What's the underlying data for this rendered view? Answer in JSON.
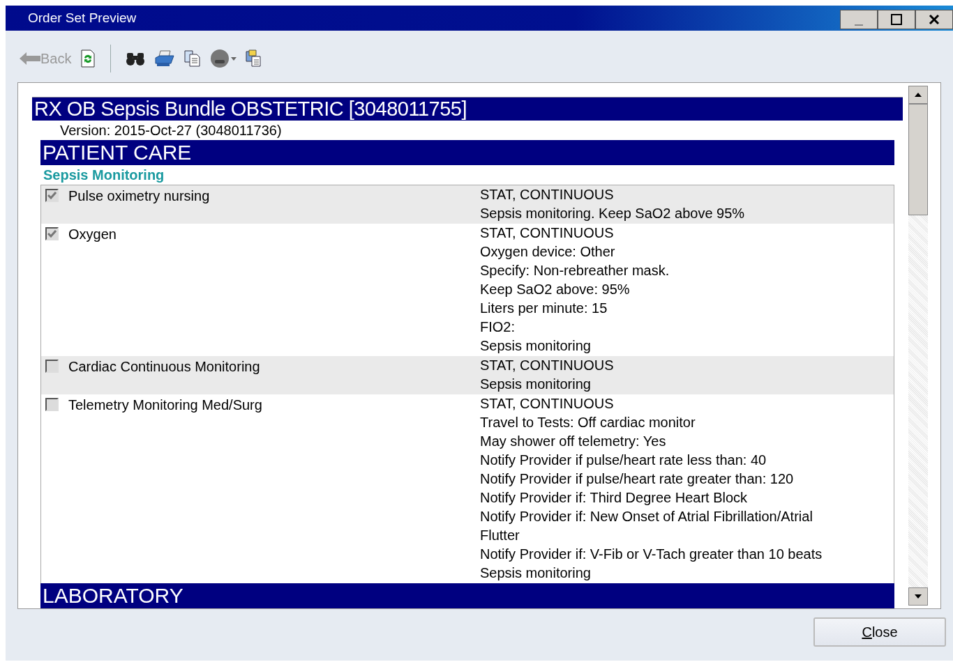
{
  "window": {
    "title": "Order Set Preview"
  },
  "toolbar": {
    "back": {
      "label": "Back",
      "disabled": true
    }
  },
  "document": {
    "title": "RX OB Sepsis Bundle OBSTETRIC [3048011755]",
    "version": "Version: 2015-Oct-27 (3048011736)",
    "sections": [
      {
        "heading": "PATIENT CARE",
        "subsections": [
          {
            "heading": "Sepsis Monitoring",
            "orders": [
              {
                "name": "Pulse oximetry nursing",
                "checked": true,
                "details": [
                  "STAT, CONTINUOUS",
                  "Sepsis monitoring. Keep SaO2 above 95%"
                ]
              },
              {
                "name": "Oxygen",
                "checked": true,
                "details": [
                  "STAT, CONTINUOUS",
                  "Oxygen device: Other",
                  "Specify: Non-rebreather mask.",
                  "Keep SaO2 above: 95%",
                  "Liters per minute: 15",
                  "FIO2:",
                  "Sepsis monitoring"
                ]
              },
              {
                "name": "Cardiac Continuous Monitoring",
                "checked": false,
                "details": [
                  "STAT, CONTINUOUS",
                  "Sepsis monitoring"
                ]
              },
              {
                "name": "Telemetry Monitoring Med/Surg",
                "checked": false,
                "details": [
                  "STAT, CONTINUOUS",
                  "Travel to Tests: Off cardiac monitor",
                  "May shower off telemetry: Yes",
                  "Notify Provider if pulse/heart rate less than: 40",
                  "Notify Provider if pulse/heart rate greater than: 120",
                  "Notify Provider if: Third Degree Heart Block",
                  "Notify Provider if: New Onset of Atrial Fibrillation/Atrial Flutter",
                  "Notify Provider if: V-Fib or V-Tach greater than 10 beats",
                  "Sepsis monitoring"
                ]
              }
            ]
          }
        ]
      },
      {
        "heading": "LABORATORY"
      }
    ]
  },
  "buttons": [
    {
      "label": "Close"
    }
  ]
}
